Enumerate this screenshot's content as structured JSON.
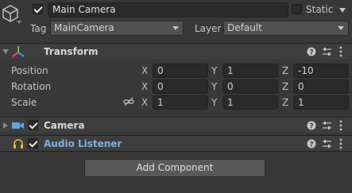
{
  "header": {
    "object_name": "Main Camera",
    "active": true,
    "static_label": "Static",
    "static": false,
    "tag_label": "Tag",
    "tag_value": "MainCamera",
    "layer_label": "Layer",
    "layer_value": "Default"
  },
  "transform": {
    "title": "Transform",
    "rows": [
      {
        "label": "Position",
        "x": "0",
        "y": "1",
        "z": "-10"
      },
      {
        "label": "Rotation",
        "x": "0",
        "y": "0",
        "z": "0"
      },
      {
        "label": "Scale",
        "x": "1",
        "y": "1",
        "z": "1"
      }
    ],
    "axes": {
      "x": "X",
      "y": "Y",
      "z": "Z"
    }
  },
  "components": [
    {
      "title": "Camera",
      "enabled": true
    },
    {
      "title": "Audio Listener",
      "enabled": true
    }
  ],
  "add_component_label": "Add Component",
  "colors": {
    "background": "#383838",
    "header_bg": "#3e3e3e",
    "camera_icon": "#5fa6e8",
    "audio_icon": "#e8b840",
    "link_text": "#7fb0e0"
  }
}
